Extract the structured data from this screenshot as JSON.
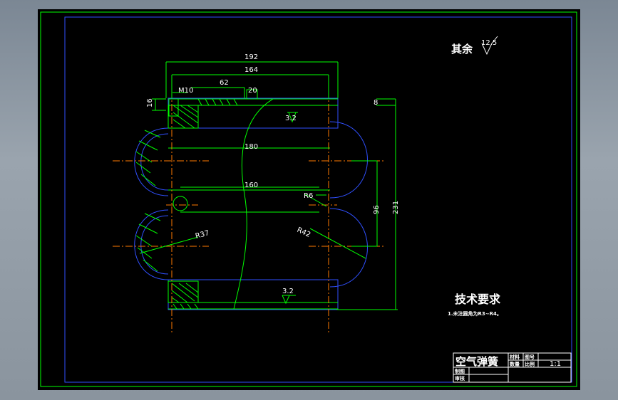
{
  "drawing": {
    "note_rough": "其余",
    "roughness_main": "12.5",
    "roughness_a": "3.2",
    "roughness_b": "3.2",
    "tech_title": "技术要求",
    "tech_note": "1.未注圆角为R3~R4。",
    "dims": {
      "d192": "192",
      "d164": "164",
      "d62": "62",
      "d20": "20",
      "m10": "M10",
      "d16": "16",
      "d8": "8",
      "d180": "180",
      "d160": "160",
      "r6": "R6",
      "d96": "96",
      "d231": "231",
      "r37": "R37",
      "r42": "R42"
    },
    "title_block": {
      "name": "空气弹簧",
      "material_label": "材料",
      "drawing_no_label": "图号",
      "quantity_label": "数量",
      "scale_label": "比例",
      "scale_value": "1:1",
      "drawn_label": "制图",
      "checked_label": "审核"
    }
  }
}
